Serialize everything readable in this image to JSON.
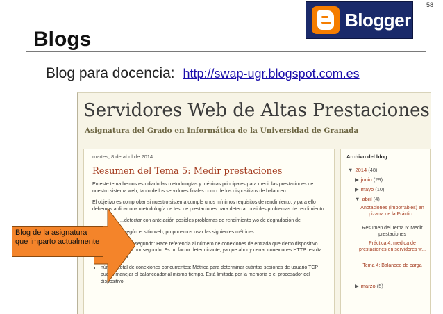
{
  "slide": {
    "number": "58",
    "title": "Blogs"
  },
  "logo": {
    "wordmark": "Blogger",
    "bg_color": "#1a2a6a",
    "icon_color": "#f57d00",
    "icon": "blogger-b-icon"
  },
  "subtitle": {
    "text": "Blog para docencia:",
    "link": "http://swap-ugr.blogspot.com.es"
  },
  "blog": {
    "title": "Servidores Web de Altas Prestaciones",
    "description": "Asignatura del Grado en Informática de la Universidad de Granada",
    "post": {
      "date": "martes, 8 de abril de 2014",
      "title": "Resumen del Tema 5: Medir prestaciones",
      "p1": "En este tema hemos estudiado las metodologías y métricas principales para medir las prestaciones de nuestro sistema web, tanto de los servidores finales como de los dispositivos de balanceo.",
      "p2": "El objetivo es comprobar si nuestro sistema cumple unos mínimos requisitos de rendimiento, y para ello debemos aplicar una metodología de test de prestaciones para detectar posibles problemas de rendimiento.",
      "p3": "...detectar con antelación posibles problemas de rendimiento y/o de degradación de",
      "p4": "...según el sitio web, proponemos usar las siguientes métricas:",
      "bullet1": "conexiones por segundo: Hace referencia al número de conexiones de entrada que cierto dispositivo puede manejar por segundo. Es un factor determinante, ya que abrir y cerrar conexiones HTTP resulta muy costoso.",
      "bullet2": "número total de conexiones concurrentes: Métrica para determinar cuántas sesiones de usuario TCP puede manejar el balanceador al mismo tiempo. Está limitada por la memoria o el procesador del dispositivo."
    },
    "archive": {
      "heading": "Archivo del blog",
      "year": "2014",
      "year_count": "(48)",
      "junio": "junio",
      "junio_count": "(29)",
      "mayo": "mayo",
      "mayo_count": "(10)",
      "abril": "abril",
      "abril_count": "(4)",
      "posts": [
        "Anotaciones (imborrables) en pizarra de la Práctic...",
        "Resumen del Tema 5: Medir prestaciones",
        "Práctica 4: medida de prestaciones en servidores w...",
        "Tema 4: Balanceo de carga"
      ],
      "marzo": "marzo",
      "marzo_count": "(5)"
    }
  },
  "callout": {
    "text": "Blog de la asignatura que imparto actualmente",
    "color": "#f4842a"
  }
}
